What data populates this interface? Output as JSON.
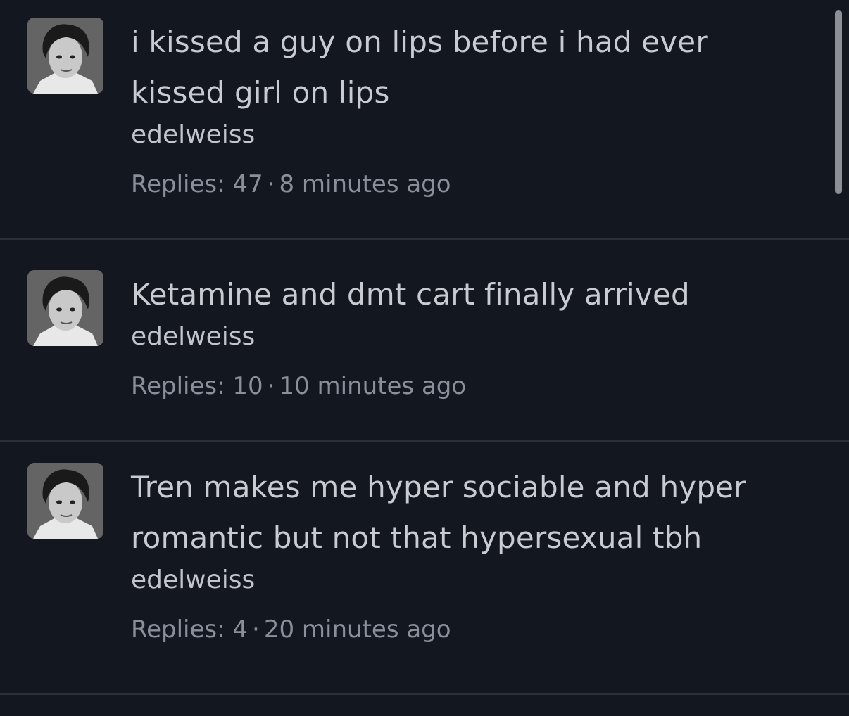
{
  "posts": [
    {
      "text": "i kissed a guy on lips before i had ever kissed girl on lips",
      "author": "edelweiss",
      "replies_label": "Replies: 47",
      "time": "8 minutes ago"
    },
    {
      "text": "Ketamine and dmt cart finally arrived",
      "author": "edelweiss",
      "replies_label": "Replies: 10",
      "time": "10 minutes ago"
    },
    {
      "text": "Tren makes me hyper sociable and hyper romantic but not that hypersexual tbh",
      "author": "edelweiss",
      "replies_label": "Replies: 4",
      "time": "20 minutes ago"
    }
  ],
  "separator": "·",
  "colors": {
    "background": "#131720",
    "text": "#c9cbd3",
    "meta": "#8b8f9a",
    "divider": "#2b2f38",
    "scrollbar": "#8c8f96"
  }
}
